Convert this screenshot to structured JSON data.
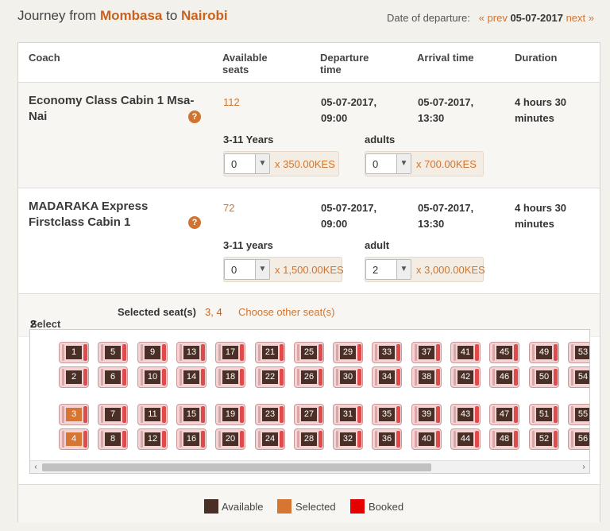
{
  "header": {
    "journey_prefix": "Journey from",
    "origin": "Mombasa",
    "to_word": "to",
    "destination": "Nairobi",
    "date_label": "Date of departure:",
    "prev_label": "« prev",
    "date": "05-07-2017",
    "next_label": "next »"
  },
  "table": {
    "columns": [
      "Coach",
      "Available seats",
      "Departure time",
      "Arrival time",
      "Duration"
    ],
    "rows": [
      {
        "coach": "Economy Class Cabin 1 Msa-Nai",
        "available": "112",
        "departure": "05-07-2017, 09:00",
        "arrival": "05-07-2017, 13:30",
        "duration": "4 hours 30 minutes",
        "help": "?",
        "fare1_label": "3-11 Years",
        "fare1_qty": "0",
        "fare1_price": "x 350.00KES",
        "fare2_label": "adults",
        "fare2_qty": "0",
        "fare2_price": "x 700.00KES"
      },
      {
        "coach": "MADARAKA Express Firstclass Cabin 1",
        "available": "72",
        "departure": "05-07-2017, 09:00",
        "arrival": "05-07-2017, 13:30",
        "duration": "4 hours 30 minutes",
        "help": "?",
        "fare1_label": "3-11 years",
        "fare1_qty": "0",
        "fare1_price": "x 1,500.00KES",
        "fare2_label": "adult",
        "fare2_qty": "2",
        "fare2_price": "x 3,000.00KES"
      }
    ]
  },
  "selection": {
    "select_prefix": "Select",
    "select_count": "2 seats",
    "selected_label": "Selected seat(s)",
    "selected_values": "3, 4",
    "choose_other": "Choose other seat(s)"
  },
  "seatmap": {
    "rows": [
      [
        "1",
        "5",
        "9",
        "13",
        "17",
        "21",
        "25",
        "29",
        "33",
        "37",
        "41",
        "45",
        "49",
        "53"
      ],
      [
        "2",
        "6",
        "10",
        "14",
        "18",
        "22",
        "26",
        "30",
        "34",
        "38",
        "42",
        "46",
        "50",
        "54"
      ],
      [
        "3",
        "7",
        "11",
        "15",
        "19",
        "23",
        "27",
        "31",
        "35",
        "39",
        "43",
        "47",
        "51",
        "55"
      ],
      [
        "4",
        "8",
        "12",
        "16",
        "20",
        "24",
        "28",
        "32",
        "36",
        "40",
        "44",
        "48",
        "52",
        "56"
      ]
    ],
    "selected": [
      "3",
      "4"
    ]
  },
  "legend": {
    "available": "Available",
    "selected": "Selected",
    "booked": "Booked",
    "available_color": "#4a2f26",
    "selected_color": "#d77633",
    "booked_color": "#e60000"
  },
  "scrollbar": {
    "left_arrow": "‹",
    "right_arrow": "›"
  }
}
